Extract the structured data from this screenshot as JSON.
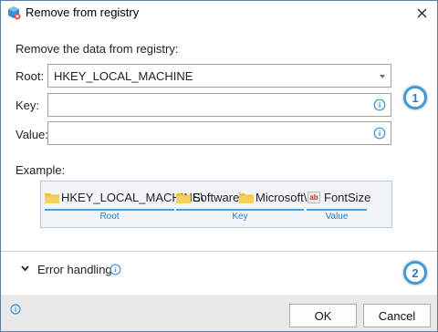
{
  "window": {
    "title": "Remove from registry"
  },
  "form": {
    "section_label": "Remove the data from registry:",
    "root_label": "Root:",
    "root_value": "HKEY_LOCAL_MACHINE",
    "key_label": "Key:",
    "key_value": "",
    "value_label": "Value:",
    "value_value": ""
  },
  "badges": {
    "one": "1",
    "two": "2"
  },
  "example": {
    "label": "Example:",
    "root_text": "HKEY_LOCAL_MACHINE\\",
    "key_part1": "Software\\",
    "key_part2": "Microsoft\\",
    "value_text": "FontSize",
    "value_icon_text": "ab",
    "caption_root": "Root",
    "caption_key": "Key",
    "caption_value": "Value"
  },
  "error_handling": {
    "label": "Error handling"
  },
  "buttons": {
    "ok": "OK",
    "cancel": "Cancel"
  },
  "colors": {
    "accent": "#3f9bd8",
    "folder": "#f5c242",
    "footer": "#e9e9e9"
  },
  "icons": [
    "app-icon",
    "close-icon",
    "dropdown-caret-icon",
    "info-icon",
    "folder-icon",
    "string-value-icon",
    "chevron-down-icon"
  ]
}
